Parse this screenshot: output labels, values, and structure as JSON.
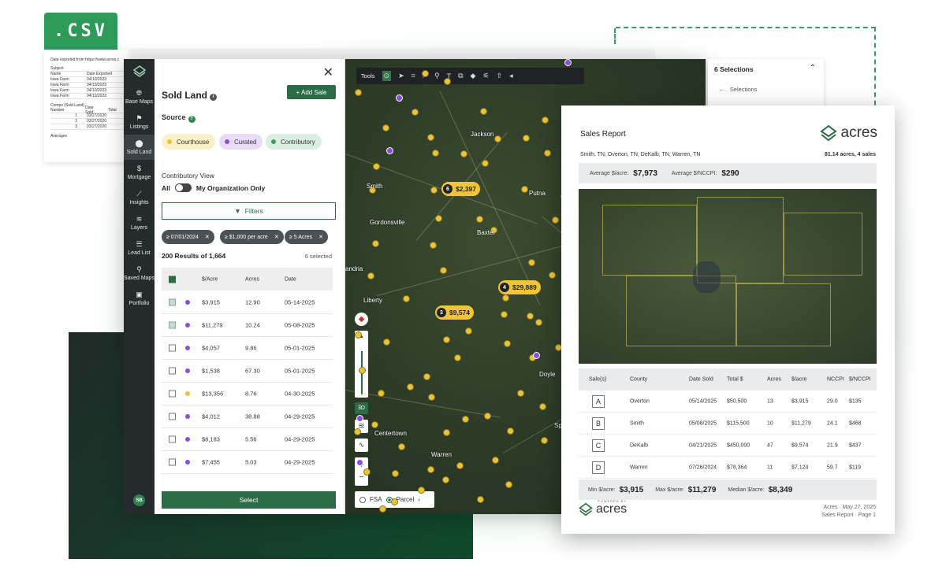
{
  "csv": {
    "tag": ".CSV",
    "export_line": "Data exported from https://www.acres.c",
    "rows": [
      [
        "Subject",
        ""
      ],
      [
        "Name",
        "Date Exported"
      ],
      [
        "Iowa Farm",
        "04/10/2023"
      ],
      [
        "Iowa Farm",
        "04/10/2023"
      ],
      [
        "Iowa Farm",
        "04/10/2023"
      ],
      [
        "Iowa Farm",
        "04/10/2023"
      ]
    ],
    "comps_title": "Comps (Sold Land)",
    "comps_header": [
      "Number",
      "Date Sold",
      "Total"
    ],
    "comps_rows": [
      [
        "1",
        "03/27/2020"
      ],
      [
        "2",
        "03/27/2020"
      ],
      [
        "3",
        "03/27/2020"
      ]
    ],
    "averages": "Averages"
  },
  "nav": {
    "items": [
      {
        "label": "Base Maps",
        "icon": "globe-icon"
      },
      {
        "label": "Listings",
        "icon": "flag-icon"
      },
      {
        "label": "Sold Land",
        "icon": "pin-icon",
        "active": true
      },
      {
        "label": "Mortgage",
        "icon": "dollar-icon"
      },
      {
        "label": "Insights",
        "icon": "chart-line-icon"
      },
      {
        "label": "Layers",
        "icon": "layers-icon"
      },
      {
        "label": "Lead List",
        "icon": "list-icon"
      },
      {
        "label": "Saved Maps",
        "icon": "pushpin-icon"
      },
      {
        "label": "Portfolio",
        "icon": "briefcase-icon"
      }
    ],
    "avatar": "SB"
  },
  "panel": {
    "title": "Sold Land",
    "add_sale": "+ Add Sale",
    "source_label": "Source",
    "chips": [
      {
        "label": "Courthouse",
        "color": "#e8c43a",
        "bg": "#fbf1c8"
      },
      {
        "label": "Curated",
        "color": "#8a4fd8",
        "bg": "#eadcf8"
      },
      {
        "label": "Contributory",
        "color": "#3f9a63",
        "bg": "#dbeee2"
      }
    ],
    "contributory_view": "Contributory View",
    "toggle_left": "All",
    "toggle_right": "My Organization Only",
    "filters": "Filters",
    "filter_chips": [
      "≥ 07/01/2024",
      "≥ $1,000 per acre",
      "≥ 5 Acres"
    ],
    "results": "200 Results of 1,664",
    "selected": "6 selected",
    "columns": [
      "$/Acre",
      "Acres",
      "Date"
    ],
    "rows": [
      {
        "checked": true,
        "color": "#8a4fd8",
        "price": "$3,915",
        "acres": "12.90",
        "date": "05-14-2025"
      },
      {
        "checked": true,
        "color": "#8a4fd8",
        "price": "$11,279",
        "acres": "10.24",
        "date": "05-08-2025"
      },
      {
        "checked": false,
        "color": "#8a4fd8",
        "price": "$4,057",
        "acres": "9.86",
        "date": "05-01-2025"
      },
      {
        "checked": false,
        "color": "#8a4fd8",
        "price": "$1,538",
        "acres": "67.30",
        "date": "05-01-2025"
      },
      {
        "checked": false,
        "color": "#e8c43a",
        "price": "$13,356",
        "acres": "8.76",
        "date": "04-30-2025"
      },
      {
        "checked": false,
        "color": "#8a4fd8",
        "price": "$4,012",
        "acres": "38.88",
        "date": "04-29-2025"
      },
      {
        "checked": false,
        "color": "#8a4fd8",
        "price": "$8,183",
        "acres": "5.56",
        "date": "04-29-2025"
      },
      {
        "checked": false,
        "color": "#8a4fd8",
        "price": "$7,455",
        "acres": "5.03",
        "date": "04-29-2025"
      }
    ],
    "select_btn": "Select"
  },
  "map": {
    "tools_label": "Tools",
    "towns": [
      "Jackson",
      "Smith",
      "Gordonsville",
      "Baxter",
      "Putna",
      "andria",
      "Liberty",
      "Doyle",
      "Centertown",
      "Warren",
      "Sp"
    ],
    "clusters": [
      {
        "count": "6",
        "value": "$2,397"
      },
      {
        "count": "4",
        "value": "$29,889"
      },
      {
        "count": "3",
        "value": "$9,574"
      }
    ],
    "ctl_3d": "3D",
    "fsa": "FSA",
    "parcel": "Parcel",
    "selections_title": "6 Selections",
    "selections_back": "Selections"
  },
  "report": {
    "title": "Sales Report",
    "brand": "acres",
    "location": "Smith, TN; Overton, TN; DeKalb, TN; Warren, TN",
    "summary": "81.14 acres, 4 sales",
    "avg_acre_label": "Average $/acre:",
    "avg_acre": "$7,973",
    "avg_nccpi_label": "Average $/NCCPI:",
    "avg_nccpi": "$290",
    "columns": [
      "Sale(s)",
      "County",
      "Date Sold",
      "Total $",
      "Acres",
      "$/acre",
      "NCCPI",
      "$/NCCPI"
    ],
    "rows": [
      [
        "A",
        "Overton",
        "05/14/2025",
        "$50,500",
        "13",
        "$3,915",
        "29.0",
        "$135"
      ],
      [
        "B",
        "Smith",
        "05/08/2025",
        "$115,500",
        "10",
        "$11,279",
        "24.1",
        "$468"
      ],
      [
        "C",
        "DeKalb",
        "04/21/2025",
        "$450,000",
        "47",
        "$9,574",
        "21.9",
        "$437"
      ],
      [
        "D",
        "Warren",
        "07/26/2024",
        "$78,364",
        "11",
        "$7,124",
        "59.7",
        "$119"
      ]
    ],
    "min_label": "Min $/acre:",
    "min": "$3,915",
    "max_label": "Max $/acre:",
    "max": "$11,279",
    "median_label": "Median $/acre:",
    "median": "$8,349",
    "powered_by": "POWERED BY",
    "footer_brand": "acres",
    "footer_line1": "Acres · May 27, 2025",
    "footer_line2": "Sales Report · Page 1"
  }
}
